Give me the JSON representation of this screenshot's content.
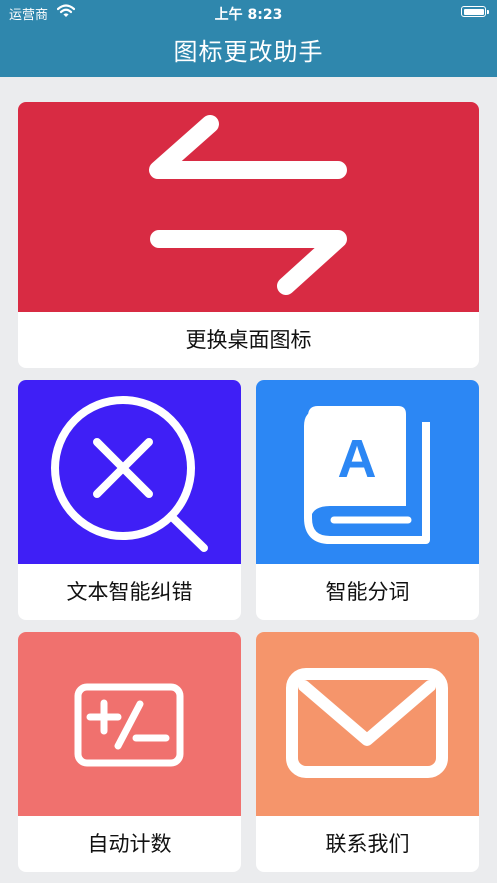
{
  "status_bar": {
    "carrier": "运营商",
    "time": "上午 8:23"
  },
  "header": {
    "title": "图标更改助手"
  },
  "cards": [
    {
      "label": "更换桌面图标",
      "icon": "swap-arrows-icon",
      "color": "#d82b43"
    },
    {
      "label": "文本智能纠错",
      "icon": "search-x-icon",
      "color": "#3f1ff6"
    },
    {
      "label": "智能分词",
      "icon": "dictionary-book-icon",
      "color": "#2c87f4"
    },
    {
      "label": "自动计数",
      "icon": "plus-minus-icon",
      "color": "#f0716e"
    },
    {
      "label": "联系我们",
      "icon": "mail-icon",
      "color": "#f5956b"
    }
  ],
  "dictionary_letter": "A"
}
